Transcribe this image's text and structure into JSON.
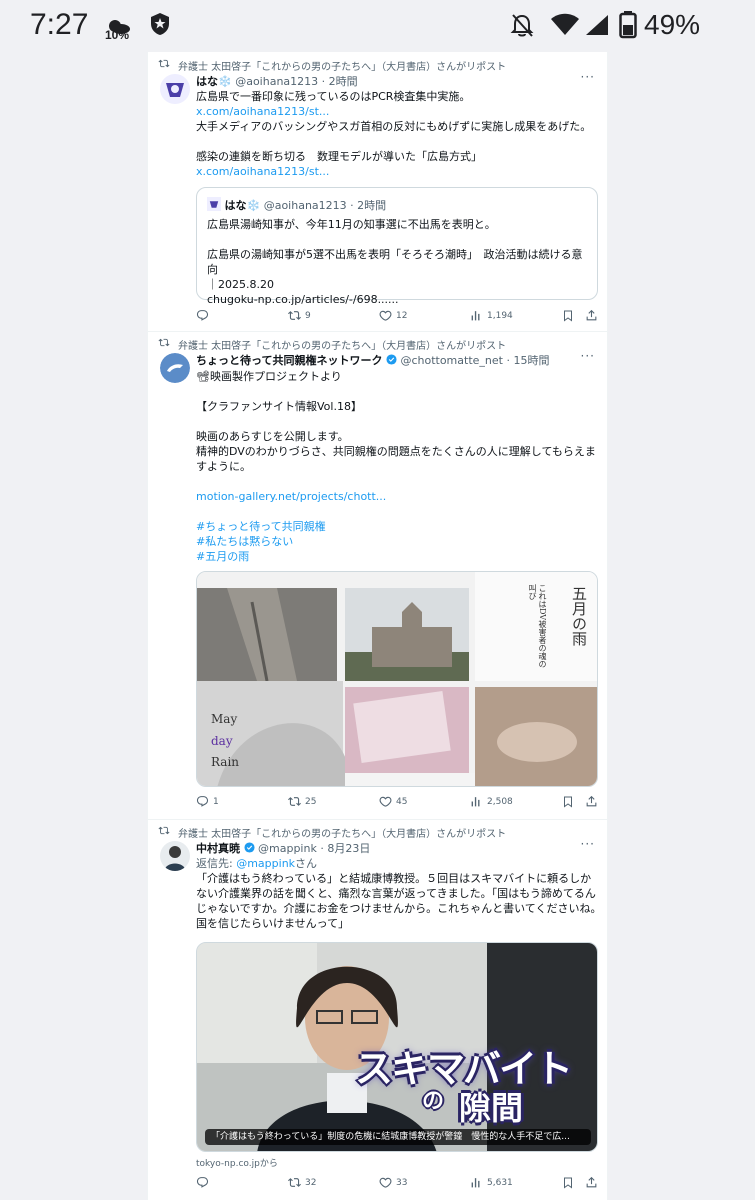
{
  "status_bar": {
    "time": "7:27",
    "weather_pct": "10%",
    "battery_pct": "49%"
  },
  "posts": [
    {
      "repost_by": "弁護士 太田啓子「これからの男の子たちへ」（大月書店）さんがリポスト",
      "name": "はな❄️",
      "handle": "@aoihana1213",
      "time": "2時間",
      "line1": "広島県で一番印象に残っているのはPCR検査集中実施。",
      "link1": "x.com/aoihana1213/st...",
      "line2": "大手メディアのバッシングやスガ首相の反対にもめげずに実施し成果をあげた。",
      "line3": "感染の連鎖を断ち切る　数理モデルが導いた「広島方式」",
      "link2": "x.com/aoihana1213/st...",
      "quote": {
        "name": "はな❄️",
        "handle": "@aoihana1213",
        "time": "2時間",
        "line1": "広島県湯崎知事が、今年11月の知事選に不出馬を表明と。",
        "line2": "広島県の湯崎知事が5選不出馬を表明「そろそろ潮時」　政治活動は続ける意向",
        "line3": "｜2025.8.20",
        "url": "chugoku-np.co.jp/articles/-/698......"
      },
      "stats": {
        "replies": "",
        "reposts": "9",
        "likes": "12",
        "views": "1,194"
      }
    },
    {
      "repost_by": "弁護士 太田啓子「これからの男の子たちへ」（大月書店）さんがリポスト",
      "name": "ちょっと待って共同親権ネットワーク",
      "handle": "@chottomatte_net",
      "time": "15時間",
      "line1": "📽映画製作プロジェクトより",
      "line2": "【クラファンサイト情報Vol.18】",
      "line3": "映画のあらすじを公開します。",
      "line4": "精神的DVのわかりづらさ、共同親権の問題点をたくさんの人に理解してもらえますように。",
      "link": "motion-gallery.net/projects/chott...",
      "tags": [
        "#ちょっと待って共同親権",
        "#私たちは黙らない",
        "#五月の雨"
      ],
      "image": {
        "title_jp": "五月の雨",
        "subtitle_jp": "これはDV被害者の魂の叫び",
        "en_1": "May",
        "en_2": "day",
        "en_3": "Rain"
      },
      "stats": {
        "replies": "1",
        "reposts": "25",
        "likes": "45",
        "views": "2,508"
      }
    },
    {
      "repost_by": "弁護士 太田啓子「これからの男の子たちへ」（大月書店）さんがリポスト",
      "name": "中村真暁",
      "handle": "@mappink",
      "time": "8月23日",
      "reply_to_prefix": "返信先:",
      "reply_to_handle": "@mappink",
      "reply_to_suffix": "さん",
      "body": "「介護はもう終わっている」と結城康博教授。５回目はスキマバイトに頼るしかない介護業界の話を聞くと、痛烈な言葉が返ってきました。「国はもう諦めてるんじゃないですか。介護にお金をつけませんから。これちゃんと書いてくださいね。国を信じたらいけませんって」",
      "image": {
        "overlay_1": "スキマバイト",
        "overlay_2": "の",
        "overlay_3": "隙間",
        "caption": "「介護はもう終わっている」制度の危機に結城康博教授が警鐘　慢性的な人手不足で広..."
      },
      "source": "tokyo-np.co.jpから",
      "stats": {
        "replies": "",
        "reposts": "32",
        "likes": "33",
        "views": "5,631"
      }
    }
  ],
  "colors": {
    "accent": "#1d9bf0",
    "text": "#0f1419",
    "muted": "#536471",
    "border": "#eff3f4"
  }
}
